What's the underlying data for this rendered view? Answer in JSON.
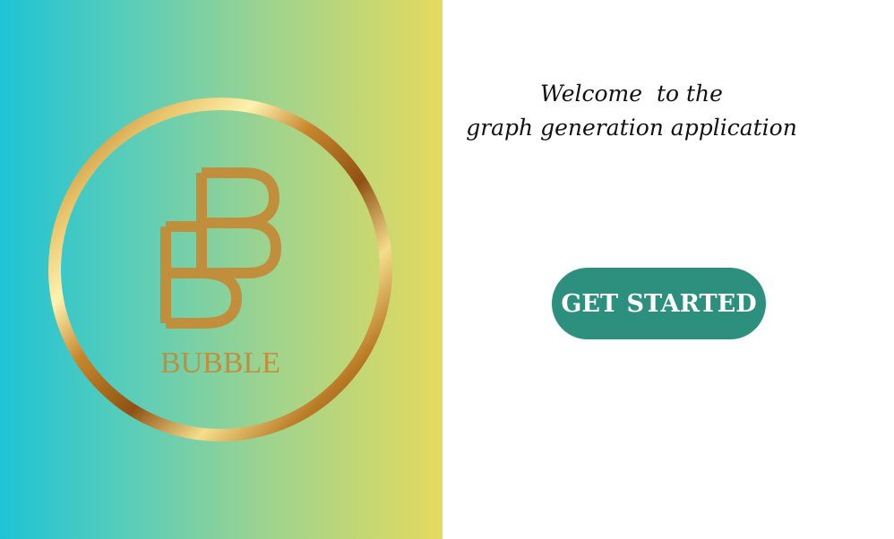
{
  "brand": {
    "name": "BUBBLE",
    "monogram": "BB",
    "gradient": [
      "#1ec3d6",
      "#5ccdb8",
      "#9dd38f",
      "#e4da5e"
    ],
    "gold_color": "#c18f3c"
  },
  "welcome": {
    "line1": "Welcome  to the",
    "line2": "graph generation application"
  },
  "cta": {
    "label": "GET STARTED",
    "color": "#2d8f7d"
  }
}
